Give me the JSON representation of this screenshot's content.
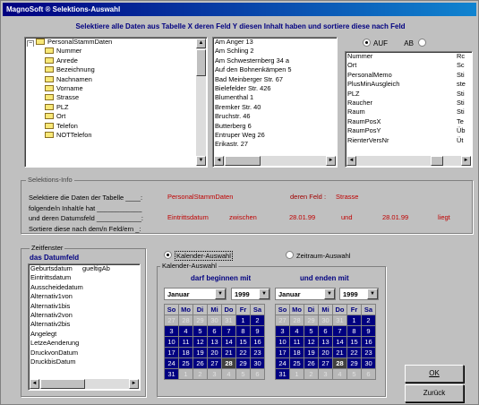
{
  "window": {
    "title": "MagnoSoft ® Selektions-Auswahl"
  },
  "header": "Selektiere alle Daten aus Tabelle X deren Feld Y diesen Inhalt haben und sortiere diese nach Feld",
  "tree": {
    "root": "PersonalStammDaten",
    "items": [
      "Nummer",
      "Anrede",
      "Bezeichnung",
      "Nachnamen",
      "Vorname",
      "Strasse",
      "PLZ",
      "Ort",
      "Telefon",
      "NOTTelefon"
    ]
  },
  "values_list": [
    "Am Anger 13",
    "Am Schling 2",
    "Am Schwesternberg 34 a",
    "Auf den Bohnenkämpen 5",
    "Bad Meinberger Str. 67",
    "Bielefelder Str. 426",
    "Blumenthal 1",
    "Bremker Str. 40",
    "Bruchstr. 46",
    "Butterberg 6",
    "Entruper Weg 26",
    "Erikastr. 27"
  ],
  "sort": {
    "option_asc": "AUF",
    "option_desc": "AB",
    "items": [
      "Nummer",
      "Ort",
      "PersonalMemo",
      "PlusMinAusgleich",
      "PLZ",
      "Raucher",
      "Raum",
      "RaumPosX",
      "RaumPosY",
      "RienterVersNr"
    ],
    "col2": [
      "Rc",
      "Sc",
      "Sti",
      "ste",
      "Sti",
      "Sti",
      "Sti",
      "Te",
      "Üb",
      "Üt"
    ]
  },
  "selection_info": {
    "label": "Selektions-Info",
    "line1": "Selektiere die Daten der Tabelle ____:",
    "line2": "folgende/n Inhalt/e hat ____________",
    "line3": "und deren Datumsfeld ____________:",
    "line4": "Sortiere diese nach dem/n Feld/ern _:",
    "table": "PersonalStammDaten",
    "field_label": "deren Feld :",
    "field": "Strasse",
    "date_field": "Eintrittsdatum",
    "between": "zwischen",
    "date_from": "28.01.99",
    "and": "und",
    "date_to": "28.01.99",
    "lies": "liegt"
  },
  "timewindow": {
    "label": "Zeitfenster",
    "sub": "das Datumfeld",
    "items": [
      "Geburtsdatum",
      "Eintrittsdatum",
      "Ausscheidedatum",
      "Alternativ1von",
      "Alternativ1bis",
      "Alternativ2von",
      "Alternativ2bis",
      "Angelegt",
      "LetzeAenderung",
      "DruckvonDatum",
      "DruckbisDatum"
    ],
    "item0_extra": "gueltigAb"
  },
  "mode": {
    "calendar": "Kalender-Auswahl",
    "period": "Zeitraum-Auswahl"
  },
  "calendar": {
    "group_label": "Kalender-Auswahl",
    "begin_label": "darf beginnen mit",
    "end_label": "und enden mit",
    "month": "Januar",
    "year": "1999",
    "weekdays": [
      "So",
      "Mo",
      "Di",
      "Mi",
      "Do",
      "Fr",
      "Sa"
    ],
    "rows": [
      [
        "27",
        "28",
        "29",
        "30",
        "31",
        "1",
        "2"
      ],
      [
        "3",
        "4",
        "5",
        "6",
        "7",
        "8",
        "9"
      ],
      [
        "10",
        "11",
        "12",
        "13",
        "14",
        "15",
        "16"
      ],
      [
        "17",
        "18",
        "19",
        "20",
        "21",
        "22",
        "23"
      ],
      [
        "24",
        "25",
        "26",
        "27",
        "28",
        "29",
        "30"
      ],
      [
        "31",
        "1",
        "2",
        "3",
        "4",
        "5",
        "6"
      ]
    ]
  },
  "buttons": {
    "ok": "OK",
    "back": "Zurück"
  }
}
